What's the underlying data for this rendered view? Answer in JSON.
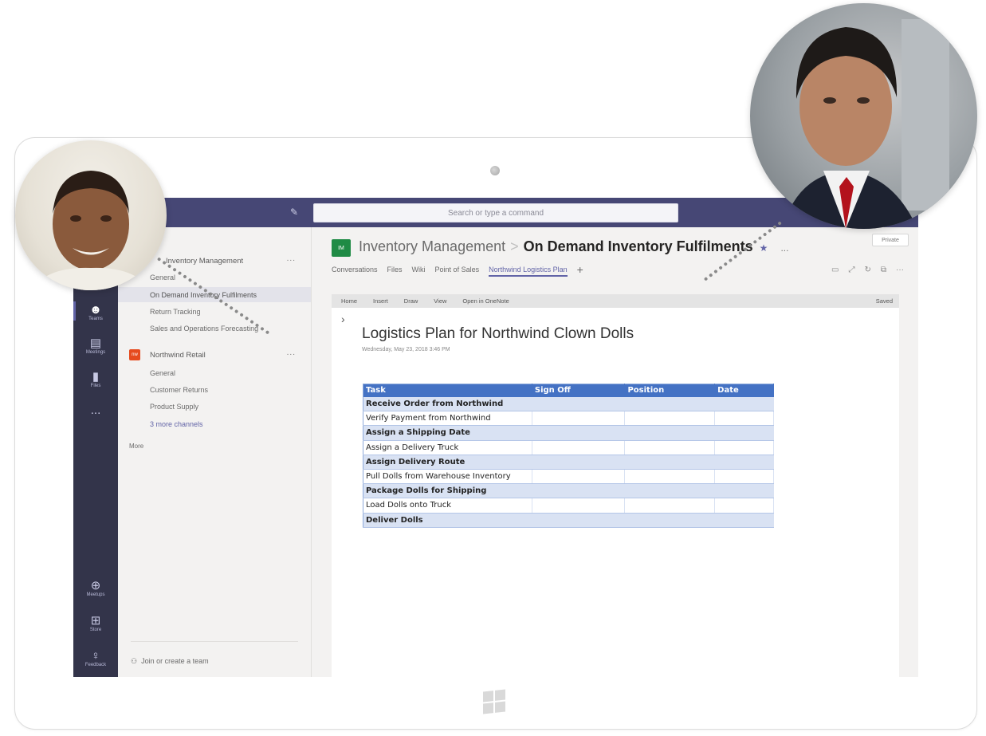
{
  "app": {
    "search_placeholder": "Search or type a command"
  },
  "appbar": {
    "items": [
      {
        "label": "Teams",
        "icon": "teams-icon"
      },
      {
        "label": "Meetings",
        "icon": "calendar-icon"
      },
      {
        "label": "Files",
        "icon": "files-icon"
      },
      {
        "label": "...",
        "icon": "more-icon"
      },
      {
        "label": "Meetups",
        "icon": "download-icon"
      },
      {
        "label": "Store",
        "icon": "store-icon"
      },
      {
        "label": "Feedback",
        "icon": "feedback-icon"
      }
    ]
  },
  "sidebar": {
    "team1": {
      "name": "Inventory Management",
      "more": "..."
    },
    "team1_channels": [
      "General",
      "On Demand Inventory Fulfilments",
      "Return Tracking",
      "Sales and Operations Forecasting"
    ],
    "team2": {
      "name": "Northwind Retail",
      "more": "...",
      "logo": "nw"
    },
    "team2_channels": [
      "General",
      "Customer Returns",
      "Product Supply",
      "3 more channels"
    ],
    "more": "More",
    "join": "Join or create a team"
  },
  "header": {
    "team": "Inventory Management",
    "separator": ">",
    "channel": "On Demand Inventory Fulfilments",
    "star": "★",
    "more": "...",
    "privacy": "Private",
    "team_icon": "IM"
  },
  "tabs": [
    "Conversations",
    "Files",
    "Wiki",
    "Point of Sales",
    "Northwind Logistics Plan"
  ],
  "tab_add": "+",
  "ribbon": {
    "items": [
      "Home",
      "Insert",
      "Draw",
      "View",
      "Open in OneNote"
    ],
    "status": "Saved"
  },
  "note": {
    "title": "Logistics Plan for Northwind Clown Dolls",
    "date": "Wednesday, May 23, 2018   3:46 PM"
  },
  "table": {
    "headers": [
      "Task",
      "Sign Off",
      "Position",
      "Date"
    ],
    "rows": [
      "Receive Order from Northwind",
      "Verify Payment from Northwind",
      "Assign a Shipping Date",
      "Assign a Delivery Truck",
      "Assign Delivery Route",
      "Pull Dolls from Warehouse Inventory",
      "Package Dolls for Shipping",
      "Load Dolls onto Truck",
      "Deliver Dolls"
    ]
  },
  "colors": {
    "brand": "#464775",
    "accent": "#6264a7",
    "app_bar": "#33344a",
    "table_header": "#4472c4",
    "team_green": "#1f8b45",
    "team_orange": "#e64b1e"
  }
}
